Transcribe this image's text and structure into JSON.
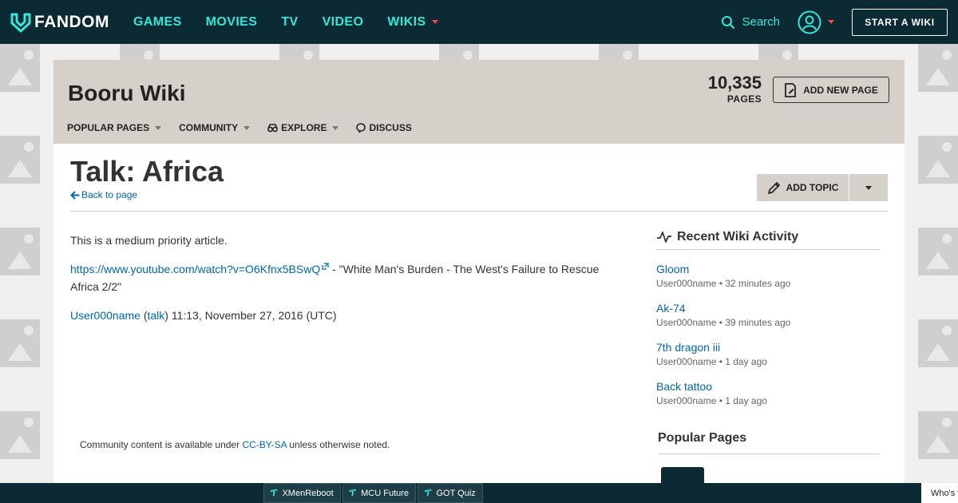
{
  "topnav": {
    "logo_text": "FANDOM",
    "links": [
      {
        "label": "GAMES"
      },
      {
        "label": "MOVIES"
      },
      {
        "label": "TV"
      },
      {
        "label": "VIDEO"
      },
      {
        "label": "WIKIS"
      }
    ],
    "search_label": "Search",
    "start_wiki_label": "START A WIKI"
  },
  "wiki_header": {
    "title": "Booru Wiki",
    "page_count": "10,335",
    "page_count_label": "PAGES",
    "add_new_page_label": "ADD NEW PAGE",
    "tabs": [
      {
        "label": "POPULAR PAGES"
      },
      {
        "label": "COMMUNITY"
      },
      {
        "label": "EXPLORE"
      },
      {
        "label": "DISCUSS"
      }
    ]
  },
  "page": {
    "title": "Talk: Africa",
    "back_link": "Back to page",
    "add_topic_label": "ADD TOPIC",
    "paragraph1": "This is a medium priority article.",
    "youtube_link": "https://www.youtube.com/watch?v=O6Kfnx5BSwQ",
    "youtube_desc": " - \"White Man's Burden - The West's Failure to Rescue Africa 2/2\"",
    "signature_user": "User000name",
    "signature_open": " (",
    "signature_talk": "talk",
    "signature_rest": ") 11:13, November 27, 2016 (UTC)",
    "license_prefix": "Community content is available under ",
    "license_link": "CC-BY-SA",
    "license_suffix": " unless otherwise noted."
  },
  "rail": {
    "activity_heading": "Recent Wiki Activity",
    "activity": [
      {
        "title": "Gloom",
        "meta": "User000name • 32 minutes ago"
      },
      {
        "title": "Ak-74",
        "meta": "User000name • 39 minutes ago"
      },
      {
        "title": "7th dragon iii",
        "meta": "User000name • 1 day ago"
      },
      {
        "title": "Back tattoo",
        "meta": "User000name • 1 day ago"
      }
    ],
    "popular_heading": "Popular Pages"
  },
  "bottom_bar": {
    "tabs": [
      {
        "label": "XMenReboot"
      },
      {
        "label": "MCU Future"
      },
      {
        "label": "GOT Quiz"
      }
    ],
    "right_text": "Who's th"
  },
  "colors": {
    "nav_bg": "#0b2a33",
    "nav_link": "#33e8d9",
    "caret_accent": "#f84a4a",
    "header_bg": "#d5d0c9",
    "link": "#0067a5"
  },
  "icons": [
    "fandom-logo-icon",
    "search-icon",
    "user-avatar-icon",
    "edit-page-icon",
    "explore-icon",
    "discuss-icon",
    "pencil-icon",
    "activity-icon",
    "back-arrow-icon",
    "external-link-icon",
    "fan-feed-icon"
  ]
}
